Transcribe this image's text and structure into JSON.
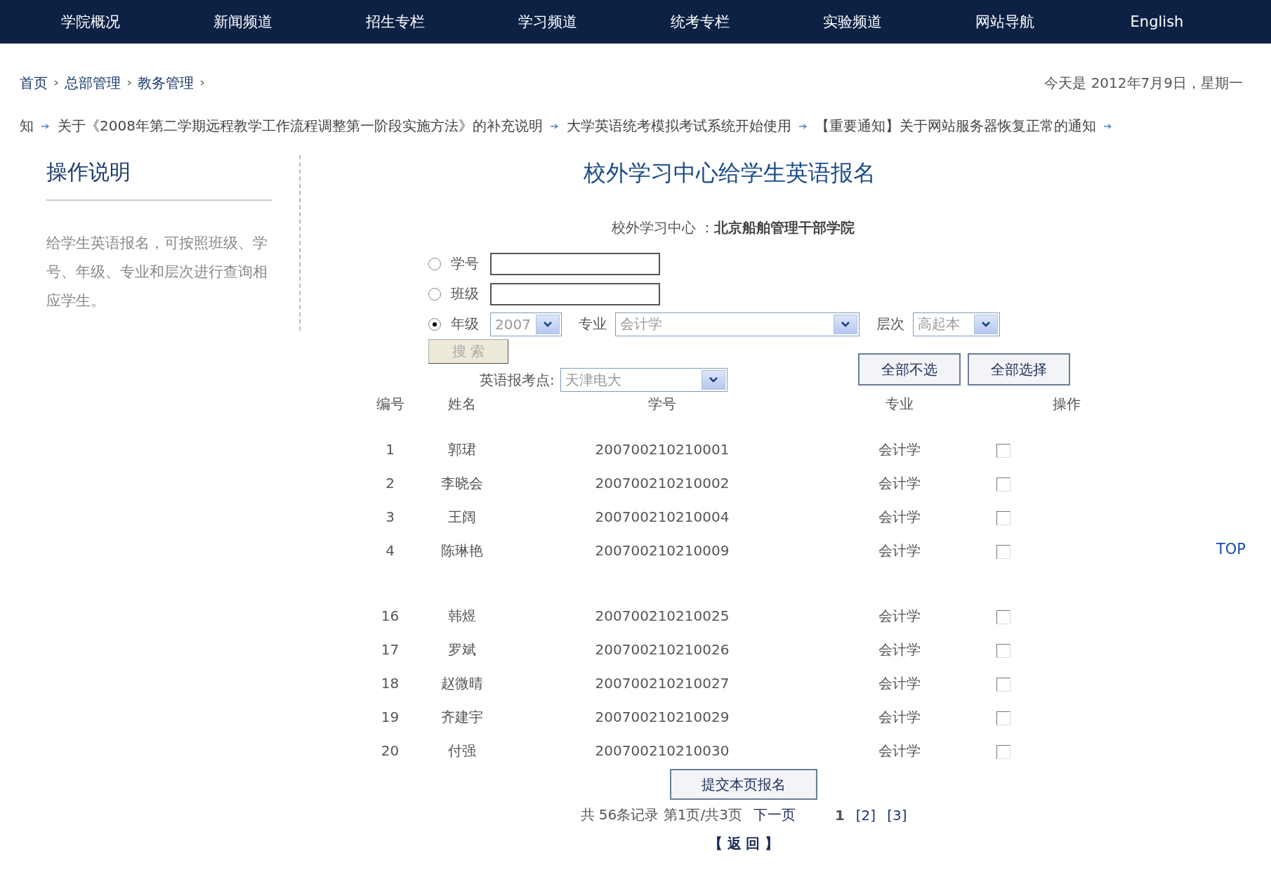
{
  "nav": [
    "学院概况",
    "新闻频道",
    "招生专栏",
    "学习频道",
    "统考专栏",
    "实验频道",
    "网站导航",
    "English"
  ],
  "breadcrumb": [
    "首页",
    "总部管理",
    "教务管理"
  ],
  "date": "今天是  2012年7月9日，星期一",
  "ticker": [
    "知",
    "关于《2008年第二学期远程教学工作流程调整第一阶段实施方法》的补充说明",
    "大学英语统考模拟考试系统开始使用",
    "【重要通知】关于网站服务器恢复正常的通知"
  ],
  "sidebar": {
    "title": "操作说明",
    "text": "给学生英语报名，可按照班级、学号、年级、专业和层次进行查询相应学生。"
  },
  "title": "校外学习中心给学生英语报名",
  "center": {
    "label": "校外学习中心 ：",
    "value": "北京船舶管理干部学院"
  },
  "search_options": [
    {
      "kind": "text",
      "label": "学号",
      "selected": false
    },
    {
      "kind": "text",
      "label": "班级",
      "selected": false
    },
    {
      "kind": "selects",
      "label": "年级",
      "selected": true,
      "grade": "2007",
      "major_label": "专业",
      "major": "会计学",
      "level_label": "层次",
      "level_value": "高起本"
    }
  ],
  "search_button": "搜 索",
  "exam_site": {
    "label": "英语报考点:",
    "value": "天津电大"
  },
  "bulk_buttons": [
    "全部不选",
    "全部选择"
  ],
  "columns": [
    "编号",
    "姓名",
    "学号",
    "专业",
    "操作"
  ],
  "row_groups": [
    [
      {
        "no": "1",
        "name": "郭珺",
        "id": "200700210210001",
        "major": "会计学",
        "checked": false
      },
      {
        "no": "2",
        "name": "李晓会",
        "id": "200700210210002",
        "major": "会计学",
        "checked": false
      },
      {
        "no": "3",
        "name": "王阔",
        "id": "200700210210004",
        "major": "会计学",
        "checked": false
      },
      {
        "no": "4",
        "name": "陈琳艳",
        "id": "200700210210009",
        "major": "会计学",
        "checked": false
      }
    ],
    [
      {
        "no": "16",
        "name": "韩煜",
        "id": "200700210210025",
        "major": "会计学",
        "checked": false
      },
      {
        "no": "17",
        "name": "罗斌",
        "id": "200700210210026",
        "major": "会计学",
        "checked": false
      },
      {
        "no": "18",
        "name": "赵微晴",
        "id": "200700210210027",
        "major": "会计学",
        "checked": false
      },
      {
        "no": "19",
        "name": "齐建宇",
        "id": "200700210210029",
        "major": "会计学",
        "checked": false
      },
      {
        "no": "20",
        "name": "付强",
        "id": "200700210210030",
        "major": "会计学",
        "checked": false
      }
    ]
  ],
  "submit_button": "提交本页报名",
  "pagination": {
    "summary": "共  56条记录  第1页/共3页",
    "next": "下一页",
    "pages": [
      {
        "label": "1",
        "selected": true
      },
      {
        "label": "[2]",
        "selected": false
      },
      {
        "label": "[3]",
        "selected": false
      }
    ]
  },
  "back": "【 返  回 】",
  "top_link": "TOP"
}
